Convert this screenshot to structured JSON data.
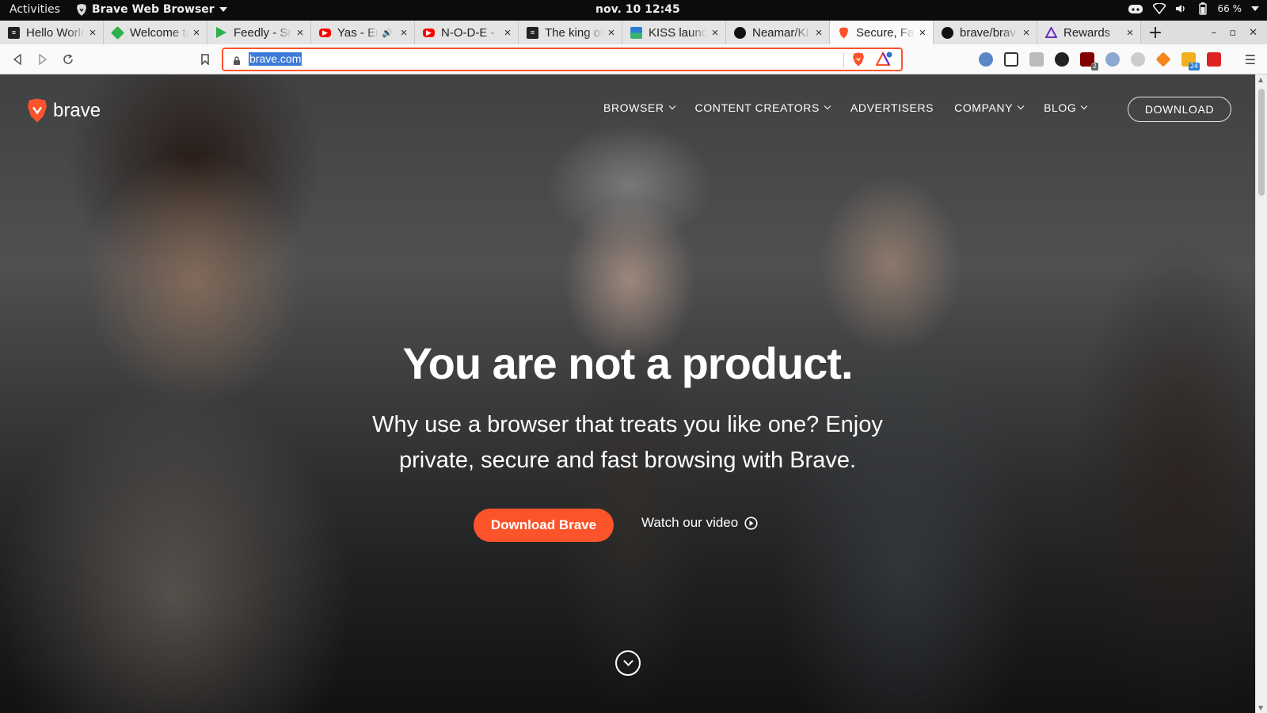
{
  "system_bar": {
    "activities": "Activities",
    "app_name": "Brave Web Browser",
    "clock": "nov. 10  12:45",
    "battery": "66 %"
  },
  "tabs": [
    {
      "title": "Hello World",
      "icon": "doc-icon",
      "color": "#222222"
    },
    {
      "title": "Welcome to",
      "icon": "diamond-icon",
      "color": "#2bb24c"
    },
    {
      "title": "Feedly - Sm",
      "icon": "play-icon",
      "color": "#2bb24c"
    },
    {
      "title": "Yas - En",
      "icon": "youtube-icon",
      "color": "#ff0000"
    },
    {
      "title": "N-O-D-E -",
      "icon": "youtube-icon",
      "color": "#ff0000"
    },
    {
      "title": "The king of",
      "icon": "doc-icon",
      "color": "#222222"
    },
    {
      "title": "KISS launc",
      "icon": "kiss-icon",
      "color": "#2a7fd4"
    },
    {
      "title": "Neamar/KI",
      "icon": "github-icon",
      "color": "#111111"
    },
    {
      "title": "Secure, Fas",
      "icon": "brave-icon",
      "color": "#fb542b"
    },
    {
      "title": "brave/brav",
      "icon": "github-icon",
      "color": "#111111"
    },
    {
      "title": "Rewards",
      "icon": "rewards-icon",
      "color": "#6b2ec2"
    }
  ],
  "address_bar": {
    "url": "brave.com"
  },
  "colors": {
    "brand_orange": "#fb542b",
    "selection_blue": "#3d7bd9"
  },
  "site": {
    "logo_text": "brave",
    "nav": [
      {
        "label": "BROWSER",
        "has_dropdown": true
      },
      {
        "label": "CONTENT CREATORS",
        "has_dropdown": true
      },
      {
        "label": "ADVERTISERS",
        "has_dropdown": false
      },
      {
        "label": "COMPANY",
        "has_dropdown": true
      },
      {
        "label": "BLOG",
        "has_dropdown": true
      }
    ],
    "download_button": "DOWNLOAD",
    "hero": {
      "title": "You are not a product.",
      "subtitle": "Why use a browser that treats you like one? Enjoy private, secure and fast browsing with Brave.",
      "cta_label": "Download Brave",
      "video_label": "Watch our video"
    }
  }
}
